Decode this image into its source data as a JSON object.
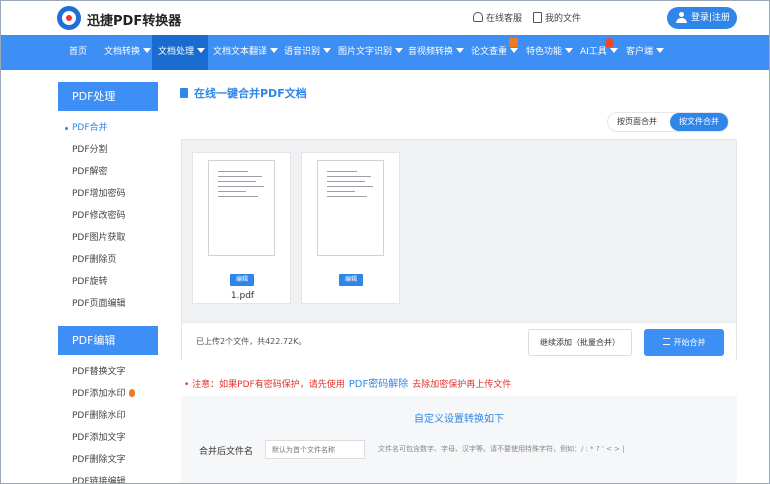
{
  "header": {
    "brand": "迅捷PDF转换器",
    "service_label": "在线客服",
    "myfiles_label": "我的文件",
    "login_label": "登录|注册"
  },
  "nav": {
    "items": [
      {
        "label": "首页",
        "caret": false
      },
      {
        "label": "文档转换",
        "caret": true
      },
      {
        "label": "文档处理",
        "caret": true,
        "active": true
      },
      {
        "label": "文档文本翻译",
        "caret": true
      },
      {
        "label": "语音识别",
        "caret": true
      },
      {
        "label": "图片文字识别",
        "caret": true
      },
      {
        "label": "音视频转换",
        "caret": true
      },
      {
        "label": "论文查重",
        "caret": true
      },
      {
        "label": "特色功能",
        "caret": true
      },
      {
        "label": "AI工具",
        "caret": true
      },
      {
        "label": "客户端",
        "caret": true
      }
    ]
  },
  "sidebar": {
    "sections": [
      {
        "title": "PDF处理",
        "items": [
          "PDF合并",
          "PDF分割",
          "PDF解密",
          "PDF增加密码",
          "PDF修改密码",
          "PDF图片获取",
          "PDF删除页",
          "PDF旋转",
          "PDF页面编辑"
        ]
      },
      {
        "title": "PDF编辑",
        "items": [
          "PDF替换文字",
          "PDF添加水印",
          "PDF删除水印",
          "PDF添加文字",
          "PDF删除文字",
          "PDF链接编辑"
        ]
      }
    ]
  },
  "main": {
    "title": "在线一键合并PDF文档",
    "mode_toggle": {
      "option_pages": "按页面合并",
      "option_files": "按文件合并",
      "selected": "option_files"
    },
    "files": [
      {
        "name": "1.pdf",
        "edit_label": "编辑"
      },
      {
        "name": "",
        "edit_label": "编辑"
      }
    ],
    "upload_status": "已上传2个文件，共422.72K。",
    "continue_button": "继续添加（批量合并）",
    "start_button": "开始合并",
    "notice_prefix": "• 注意：如果PDF有密码保护，请先使用",
    "notice_link": "PDF密码解除",
    "notice_suffix": "去除加密保护再上传文件",
    "settings": {
      "title": "自定义设置转换如下",
      "filename_label": "合并后文件名",
      "filename_placeholder": "默认为首个文件名称",
      "hint": "文件名可包含数字、字母、汉字等。请不要使用特殊字符，例如：/ : * ? ' < > |"
    }
  },
  "colors": {
    "primary": "#3d8ef5",
    "nav_active": "#1a6bd0",
    "notice_red": "#e2312a"
  }
}
